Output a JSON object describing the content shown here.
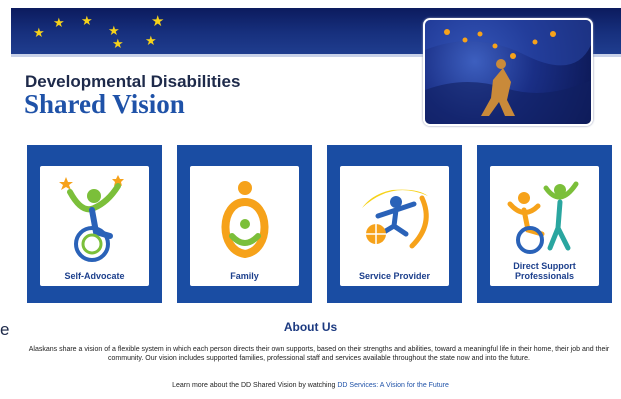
{
  "header": {
    "title_line1": "Developmental Disabilities",
    "title_line2": "Shared Vision"
  },
  "tiles": [
    {
      "label": "Self-Advocate",
      "icon": "self-advocate-icon"
    },
    {
      "label": "Family",
      "icon": "family-icon"
    },
    {
      "label": "Service Provider",
      "icon": "service-provider-icon"
    },
    {
      "label_line1": "Direct Support",
      "label_line2": "Professionals",
      "icon": "direct-support-icon"
    }
  ],
  "edge_text": "e",
  "about": {
    "heading": "About Us",
    "body": "Alaskans share a vision of a flexible system in which each person directs their own supports, based on their strengths and abilities, toward a meaningful life in their home, their job and their community. Our vision includes supported families, professional staff and services available throughout the state now and into the future.",
    "learn_prefix": "Learn more about the DD Shared Vision by watching",
    "learn_link": "DD Services: A Vision for the Future"
  },
  "colors": {
    "tile_blue": "#1a4da3",
    "banner_navy": "#0c1b5e",
    "star_gold": "#f6d21a",
    "link_blue": "#1f52a8"
  }
}
